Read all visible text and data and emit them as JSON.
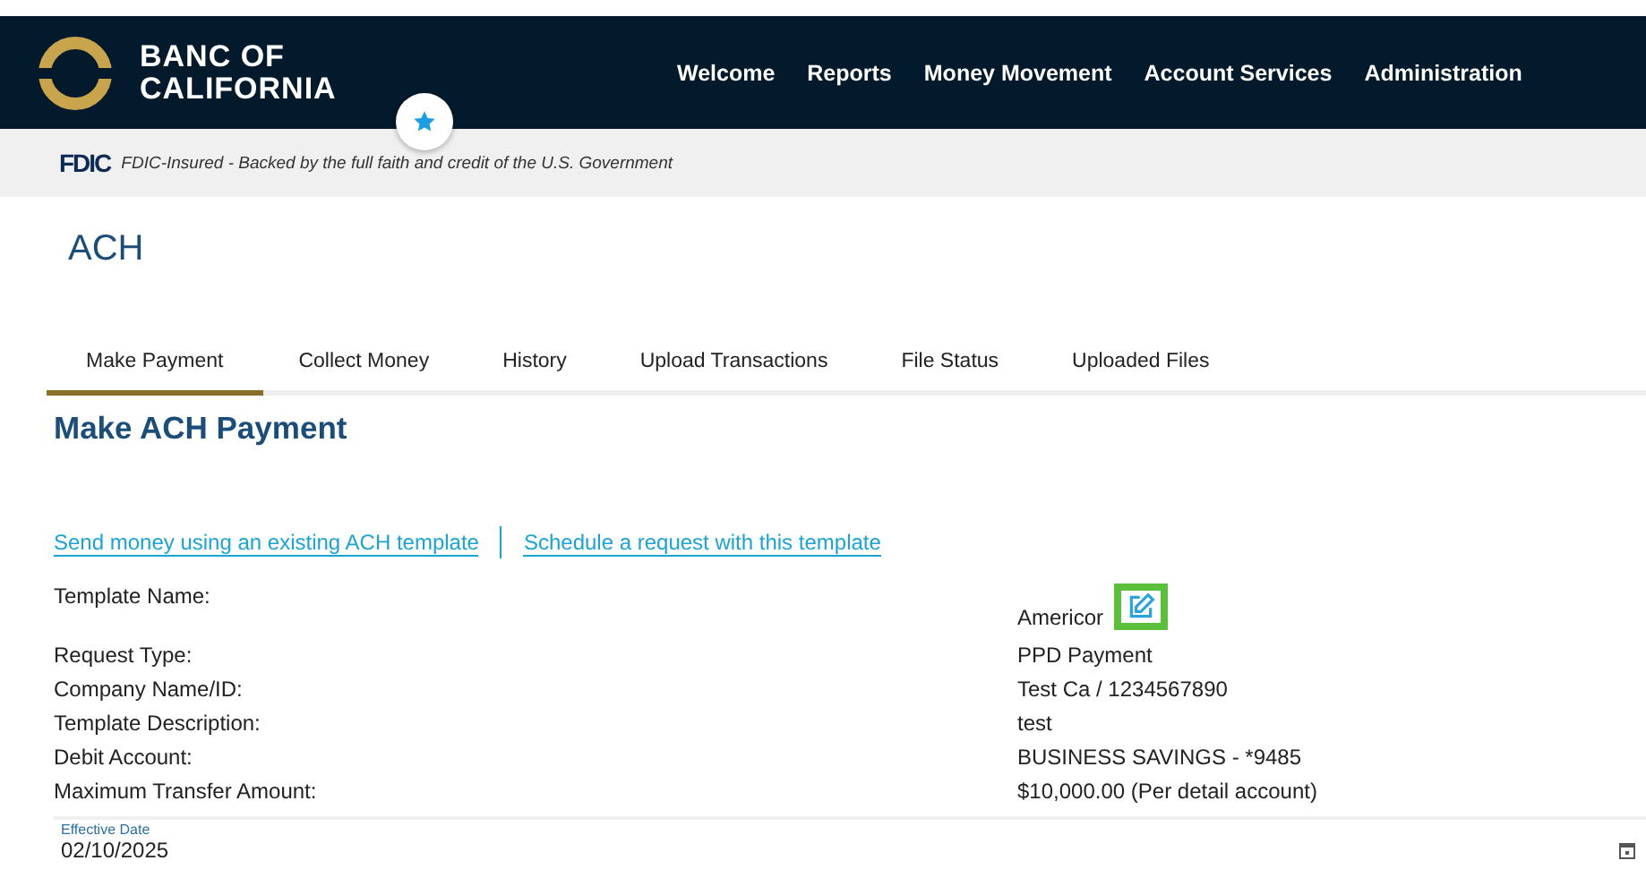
{
  "brand": {
    "line1": "BANC OF",
    "line2": "CALIFORNIA"
  },
  "nav": [
    {
      "label": "Welcome"
    },
    {
      "label": "Reports"
    },
    {
      "label": "Money Movement"
    },
    {
      "label": "Account Services"
    },
    {
      "label": "Administration"
    }
  ],
  "fdic": {
    "logo": "FDIC",
    "text": "FDIC-Insured - Backed by the full faith and credit of the U.S. Government"
  },
  "page_title": "ACH",
  "tabs": [
    {
      "label": "Make Payment",
      "selected": true
    },
    {
      "label": "Collect Money",
      "selected": false
    },
    {
      "label": "History",
      "selected": false
    },
    {
      "label": "Upload Transactions",
      "selected": false
    },
    {
      "label": "File Status",
      "selected": false
    },
    {
      "label": "Uploaded Files",
      "selected": false
    }
  ],
  "section_title": "Make ACH Payment",
  "links": [
    "Send money using an existing ACH template",
    "Schedule a request with this template"
  ],
  "details": [
    {
      "label": "Template Name:",
      "value": "Americor",
      "editable": true
    },
    {
      "label": "Request Type:",
      "value": "PPD Payment",
      "editable": false
    },
    {
      "label": "Company Name/ID:",
      "value": "Test Ca / 1234567890",
      "editable": false
    },
    {
      "label": "Template Description:",
      "value": "test",
      "editable": false
    },
    {
      "label": "Debit Account:",
      "value": "BUSINESS SAVINGS - *9485",
      "editable": false
    },
    {
      "label": "Maximum Transfer Amount:",
      "value": "$10,000.00 (Per detail account)",
      "editable": false
    }
  ],
  "effective_date": {
    "label": "Effective Date",
    "value": "02/10/2025"
  }
}
